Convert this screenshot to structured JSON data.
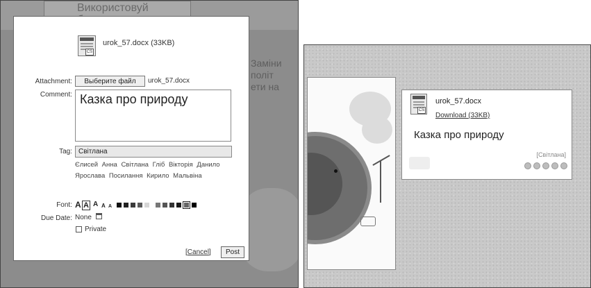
{
  "left": {
    "background": {
      "heading": "Використовуй\nбаластування",
      "side_text": "Заміни\nполіт\nети на"
    },
    "dialog": {
      "file_title": "urok_57.docx (33KB)",
      "doc_badge": "CS",
      "attachment": {
        "label": "Attachment:",
        "button": "Выберите файл",
        "file_name": "urok_57.docx"
      },
      "comment": {
        "label": "Comment:",
        "value": "Казка про природу"
      },
      "tag": {
        "label": "Tag:",
        "value": "Світлана",
        "suggestions": [
          "Єлисей",
          "Анна",
          "Світлана",
          "Гліб",
          "Вікторія",
          "Данило",
          "Ярослава",
          "Посилання",
          "Кирило",
          "Мальвіна"
        ]
      },
      "font": {
        "label": "Font:",
        "sizes": [
          "A",
          "A",
          "A",
          "A",
          "A"
        ],
        "selected_size_index": 1,
        "colors": [
          "#111111",
          "#222222",
          "#3a3a3a",
          "#5a5a5a",
          "#d6d6d6",
          "#777777",
          "#555555",
          "#333333",
          "#1a1a1a",
          "#666666",
          "#000000"
        ],
        "selected_color_index": 9
      },
      "due_date": {
        "label": "Due Date:",
        "value": "None",
        "icon": "calendar-icon"
      },
      "private": {
        "label": "Private",
        "checked": false
      },
      "cancel": "Cancel",
      "post": "Post"
    }
  },
  "right": {
    "note": {
      "file_name": "urok_57.docx",
      "doc_badge": "CS",
      "download": "Download (33KB)",
      "text": "Казка про природу",
      "tag": "[Світлана]",
      "actions": [
        "edit-icon",
        "minus-icon",
        "info-icon",
        "tag-icon",
        "close-icon"
      ]
    }
  }
}
